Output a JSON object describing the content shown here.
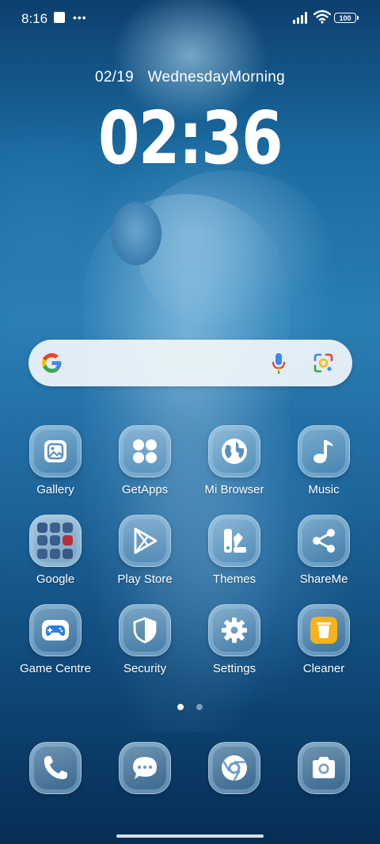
{
  "status_bar": {
    "time": "8:16",
    "battery": "100"
  },
  "lockscreen": {
    "date": "02/19",
    "day_period": "WednesdayMorning",
    "clock": "02:36"
  },
  "search": {
    "logo": "google-g-icon",
    "voice_icon": "mic-icon",
    "lens_icon": "lens-icon"
  },
  "apps": [
    {
      "label": "Gallery",
      "icon": "gallery-icon"
    },
    {
      "label": "GetApps",
      "icon": "getapps-icon"
    },
    {
      "label": "Mi Browser",
      "icon": "globe-icon"
    },
    {
      "label": "Music",
      "icon": "music-note-icon"
    },
    {
      "label": "Google",
      "icon": "folder-icon"
    },
    {
      "label": "Play Store",
      "icon": "play-store-icon"
    },
    {
      "label": "Themes",
      "icon": "themes-icon"
    },
    {
      "label": "ShareMe",
      "icon": "share-icon"
    },
    {
      "label": "Game Centre",
      "icon": "gamepad-icon"
    },
    {
      "label": "Security",
      "icon": "shield-icon"
    },
    {
      "label": "Settings",
      "icon": "gear-icon"
    },
    {
      "label": "Cleaner",
      "icon": "trash-icon"
    }
  ],
  "dock": [
    {
      "icon": "phone-icon"
    },
    {
      "icon": "messages-icon"
    },
    {
      "icon": "chrome-icon"
    },
    {
      "icon": "camera-icon"
    }
  ],
  "pager": {
    "pages": 2,
    "current": 1
  },
  "colors": {
    "accent": "#ffffff",
    "google_blue": "#4285F4",
    "google_red": "#EA4335",
    "google_yellow": "#FBBC05",
    "google_green": "#34A853",
    "cleaner_yellow": "#F6B21A",
    "gamepad_blue": "#2B7FE0"
  }
}
